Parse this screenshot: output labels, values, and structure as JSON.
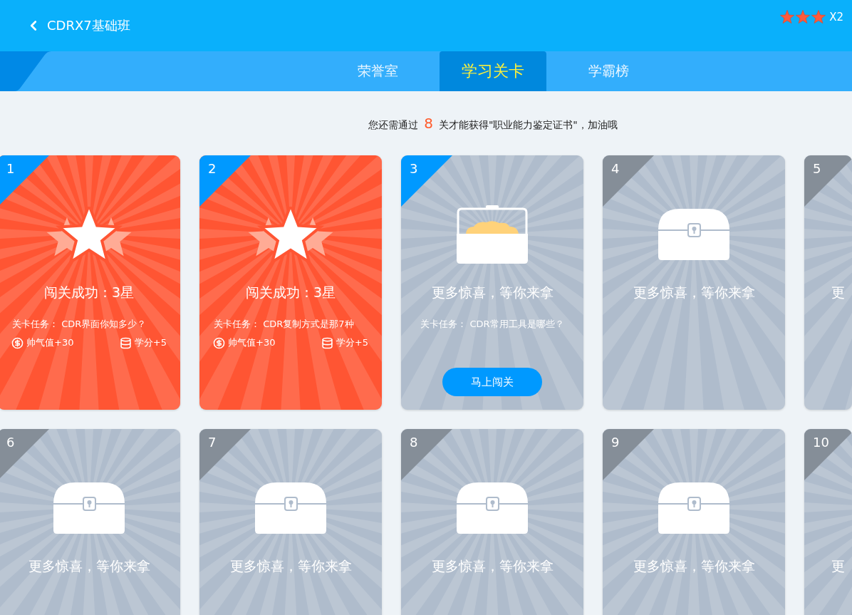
{
  "header": {
    "title": "CDRX7基础班",
    "stars": 3,
    "multiplier": "X2"
  },
  "tabs": [
    {
      "label": "荣誉室",
      "selected": false
    },
    {
      "label": "学习关卡",
      "selected": true
    },
    {
      "label": "学霸榜",
      "selected": false
    }
  ],
  "notice": {
    "before": "您还需通过",
    "count": "8",
    "after": "关才能获得\"职业能力鉴定证书\"，加油哦"
  },
  "levels": [
    {
      "number": "1",
      "kind": "passed",
      "title": "闯关成功：3星",
      "task": "关卡任务： CDR界面你知多少？",
      "rewards": [
        {
          "kind": "coin",
          "label": "帅气值+30"
        },
        {
          "kind": "credit",
          "label": "学分+5"
        }
      ]
    },
    {
      "number": "2",
      "kind": "passed",
      "title": "闯关成功：3星",
      "task": "关卡任务： CDR复制方式是那7种",
      "rewards": [
        {
          "kind": "coin",
          "label": "帅气值+30"
        },
        {
          "kind": "credit",
          "label": "学分+5"
        }
      ]
    },
    {
      "number": "3",
      "kind": "current",
      "title": "更多惊喜，等你来拿",
      "task": "关卡任务： CDR常用工具是哪些？",
      "button": "马上闯关"
    },
    {
      "number": "4",
      "kind": "locked",
      "title": "更多惊喜，等你来拿"
    },
    {
      "number": "5",
      "kind": "locked",
      "title": "更"
    },
    {
      "number": "6",
      "kind": "locked",
      "title": "更多惊喜，等你来拿"
    },
    {
      "number": "7",
      "kind": "locked",
      "title": "更多惊喜，等你来拿"
    },
    {
      "number": "8",
      "kind": "locked",
      "title": "更多惊喜，等你来拿"
    },
    {
      "number": "9",
      "kind": "locked",
      "title": "更多惊喜，等你来拿"
    },
    {
      "number": "10",
      "kind": "locked",
      "title": "更"
    }
  ]
}
